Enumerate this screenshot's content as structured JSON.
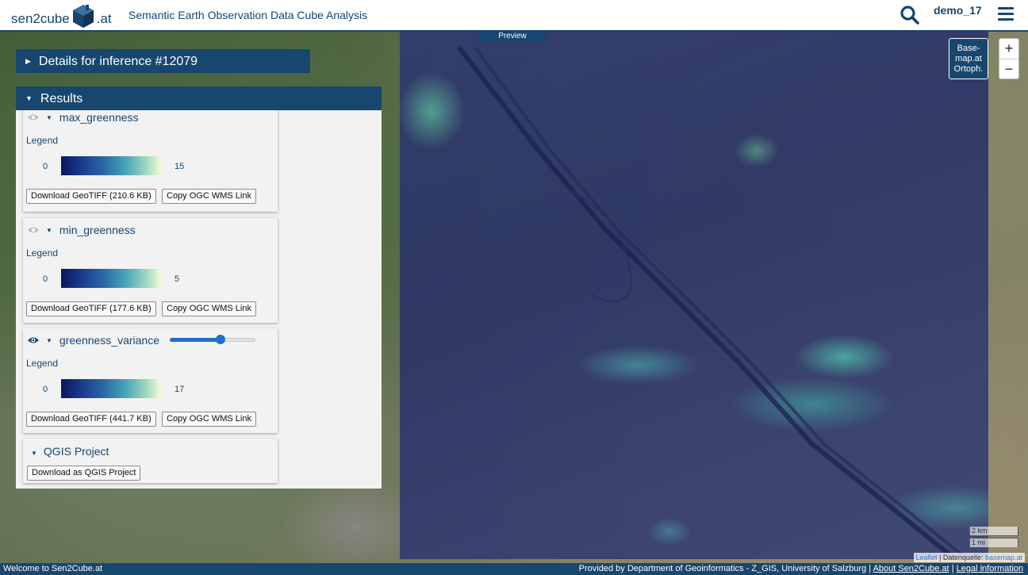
{
  "header": {
    "logo_prefix": "sen2cube",
    "logo_suffix": ".at",
    "app_title": "Semantic Earth Observation Data Cube Analysis",
    "user_name": "demo_17"
  },
  "map": {
    "preview_label": "Preview",
    "zoom_in": "+",
    "zoom_out": "−",
    "basemap_button": [
      "Base-",
      "map.at",
      "Ortoph."
    ],
    "scale": [
      "2 km",
      "1 mi"
    ],
    "attribution": {
      "leaflet": "Leaflet",
      "separator": "| Datenquelle:",
      "source": "basemap.at"
    }
  },
  "details_panel": {
    "title": "Details for inference #12079"
  },
  "results_panel": {
    "title": "Results",
    "layers": [
      {
        "name": "max_greenness",
        "visible": false,
        "legend_label": "Legend",
        "legend_min": "0",
        "legend_max": "15",
        "download_label": "Download GeoTIFF (210.6 KB)",
        "copy_label": "Copy OGC WMS Link"
      },
      {
        "name": "min_greenness",
        "visible": false,
        "legend_label": "Legend",
        "legend_min": "0",
        "legend_max": "5",
        "download_label": "Download GeoTIFF (177.6 KB)",
        "copy_label": "Copy OGC WMS Link"
      },
      {
        "name": "greenness_variance",
        "visible": true,
        "opacity": 0.6,
        "legend_label": "Legend",
        "legend_min": "0",
        "legend_max": "17",
        "download_label": "Download GeoTIFF (441.7 KB)",
        "copy_label": "Copy OGC WMS Link"
      }
    ],
    "qgis": {
      "title": "QGIS Project",
      "download_label": "Download as QGIS Project"
    }
  },
  "footer": {
    "welcome": "Welcome to Sen2Cube.at",
    "provided_by": "Provided by Department of Geoinformatics - Z_GIS, University of Salzburg",
    "about_link": "About Sen2Cube.at",
    "legal_link": "Legal information"
  },
  "colors": {
    "brand": "#17466e",
    "slider": "#1f6ec9",
    "legend_ramp": [
      "#0c1660",
      "#2d6ea5",
      "#49a6b8",
      "#9fd7bf",
      "#f4fbd8"
    ]
  }
}
